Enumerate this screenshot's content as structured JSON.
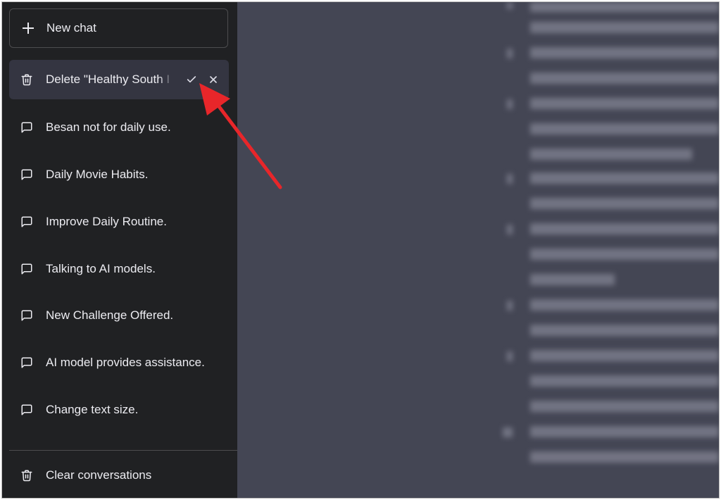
{
  "sidebar": {
    "new_chat_label": "New chat",
    "active_item": {
      "label": "Delete \"Healthy South I",
      "icon": "trash-icon",
      "confirm_icon": "check-icon",
      "cancel_icon": "close-icon"
    },
    "items": [
      {
        "label": "Besan not for daily use.",
        "icon": "chat-bubble-icon"
      },
      {
        "label": "Daily Movie Habits.",
        "icon": "chat-bubble-icon"
      },
      {
        "label": "Improve Daily Routine.",
        "icon": "chat-bubble-icon"
      },
      {
        "label": "Talking to AI models.",
        "icon": "chat-bubble-icon"
      },
      {
        "label": "New Challenge Offered.",
        "icon": "chat-bubble-icon"
      },
      {
        "label": "AI model provides assistance.",
        "icon": "chat-bubble-icon"
      },
      {
        "label": "Change text size.",
        "icon": "chat-bubble-icon"
      }
    ],
    "clear_label": "Clear conversations"
  },
  "colors": {
    "sidebar_bg": "#202123",
    "active_bg": "#343541",
    "main_bg": "#444654",
    "text": "#ececf1",
    "arrow": "#e8262a"
  }
}
